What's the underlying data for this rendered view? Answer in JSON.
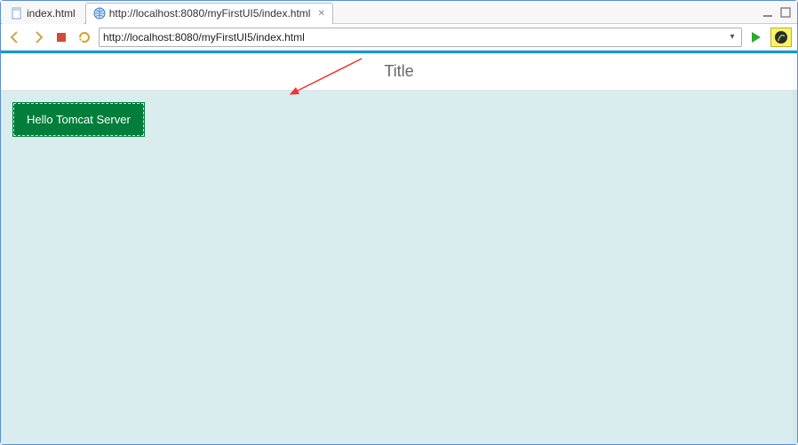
{
  "tabs": [
    {
      "label": "index.html",
      "icon": "file-icon",
      "active": false
    },
    {
      "label": "http://localhost:8080/myFirstUI5/index.html",
      "icon": "globe-icon",
      "active": true
    }
  ],
  "toolbar": {
    "back": "Back",
    "forward": "Forward",
    "stop": "Stop",
    "refresh": "Refresh",
    "url": "http://localhost:8080/myFirstUI5/index.html",
    "go": "Go"
  },
  "page": {
    "title": "Title",
    "button_label": "Hello Tomcat Server"
  }
}
